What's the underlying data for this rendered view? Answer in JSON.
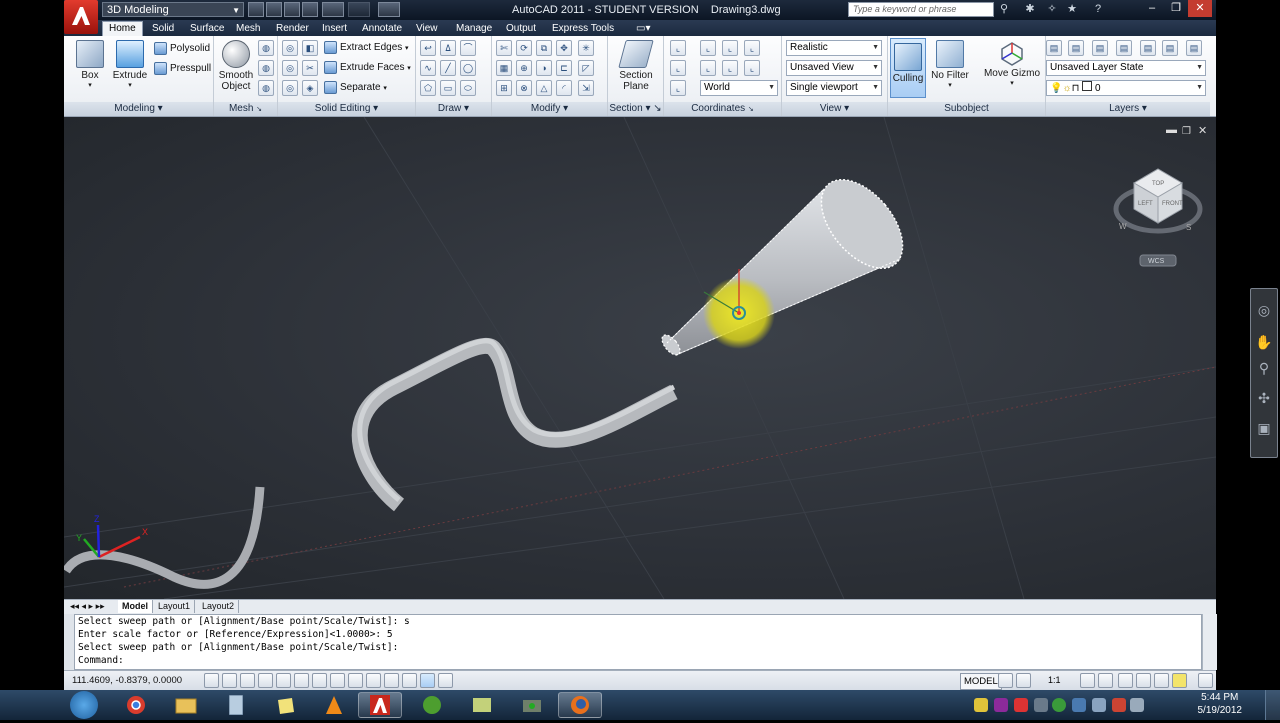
{
  "titlebar": {
    "workspace": "3D Modeling",
    "app_title": "AutoCAD 2011 - STUDENT VERSION",
    "document": "Drawing3.dwg",
    "search_placeholder": "Type a keyword or phrase"
  },
  "tabs": [
    "Home",
    "Solid",
    "Surface",
    "Mesh",
    "Render",
    "Insert",
    "Annotate",
    "View",
    "Manage",
    "Output",
    "Express Tools"
  ],
  "active_tab": "Home",
  "ribbon": {
    "modeling": {
      "box": "Box",
      "extrude": "Extrude",
      "polysolid": "Polysolid",
      "presspull": "Presspull",
      "title": "Modeling"
    },
    "mesh": {
      "smooth_object_1": "Smooth",
      "smooth_object_2": "Object",
      "title": "Mesh"
    },
    "solid_editing": {
      "extract_edges": "Extract Edges",
      "extrude_faces": "Extrude Faces",
      "separate": "Separate",
      "title": "Solid Editing"
    },
    "draw": {
      "title": "Draw"
    },
    "modify": {
      "title": "Modify"
    },
    "section": {
      "label_1": "Section",
      "label_2": "Plane",
      "title": "Section"
    },
    "coordinates": {
      "world": "World",
      "title": "Coordinates"
    },
    "view": {
      "visual_style": "Realistic",
      "named_view": "Unsaved View",
      "viewport": "Single viewport",
      "title": "View"
    },
    "subobject": {
      "culling": "Culling",
      "no_filter": "No Filter",
      "move_gizmo": "Move Gizmo",
      "title": "Subobject"
    },
    "layers": {
      "layer_state": "Unsaved Layer State",
      "layer": "0",
      "title": "Layers"
    }
  },
  "viewcube": {
    "top": "TOP",
    "left": "LEFT",
    "front": "FRONT",
    "compass_w": "W",
    "compass_s": "S",
    "wcs": "WCS"
  },
  "layout_tabs": [
    "Model",
    "Layout1",
    "Layout2"
  ],
  "command_history": [
    "Select sweep path or [Alignment/Base point/Scale/Twist]: s",
    "Enter scale factor or [Reference/Expression]<1.0000>: 5",
    "Select sweep path or [Alignment/Base point/Scale/Twist]:"
  ],
  "command_prompt": "Command:",
  "statusbar": {
    "coordinates": "111.4609, -0.8379, 0.0000",
    "model": "MODEL",
    "scale": "1:1"
  },
  "taskbar": {
    "time": "5:44 PM",
    "date": "5/19/2012"
  },
  "colors": {
    "title_bg": "#0c1624",
    "viewport_bg": "#2c3037",
    "highlight": "#d6d21a",
    "solid": "#b5b8bc"
  }
}
